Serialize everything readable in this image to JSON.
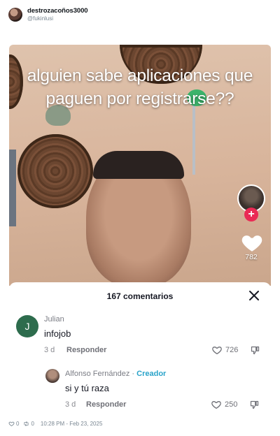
{
  "post": {
    "display_name": "destrozacoños3000",
    "handle": "@fukinlusi",
    "footer": {
      "likes": "0",
      "retweets": "0",
      "timestamp": "10:28 PM - Feb 23, 2025"
    }
  },
  "video": {
    "caption": "alguien sabe aplicaciones que paguen por registrarse??",
    "like_count": "782",
    "plus": "+"
  },
  "comments_sheet": {
    "title": "167 comentarios",
    "comments": [
      {
        "avatar_letter": "J",
        "author": "Julian",
        "text": "infojob",
        "age": "3 d",
        "reply_label": "Responder",
        "likes": "726"
      },
      {
        "author": "Alfonso Fernández",
        "separator": "·",
        "badge": "Creador",
        "text": "si y tú raza",
        "age": "3 d",
        "reply_label": "Responder",
        "likes": "250"
      }
    ]
  },
  "colors": {
    "accent_red": "#ea2a55",
    "creator_blue": "#2aa3c9",
    "avatar_green": "#2d6c4d"
  }
}
